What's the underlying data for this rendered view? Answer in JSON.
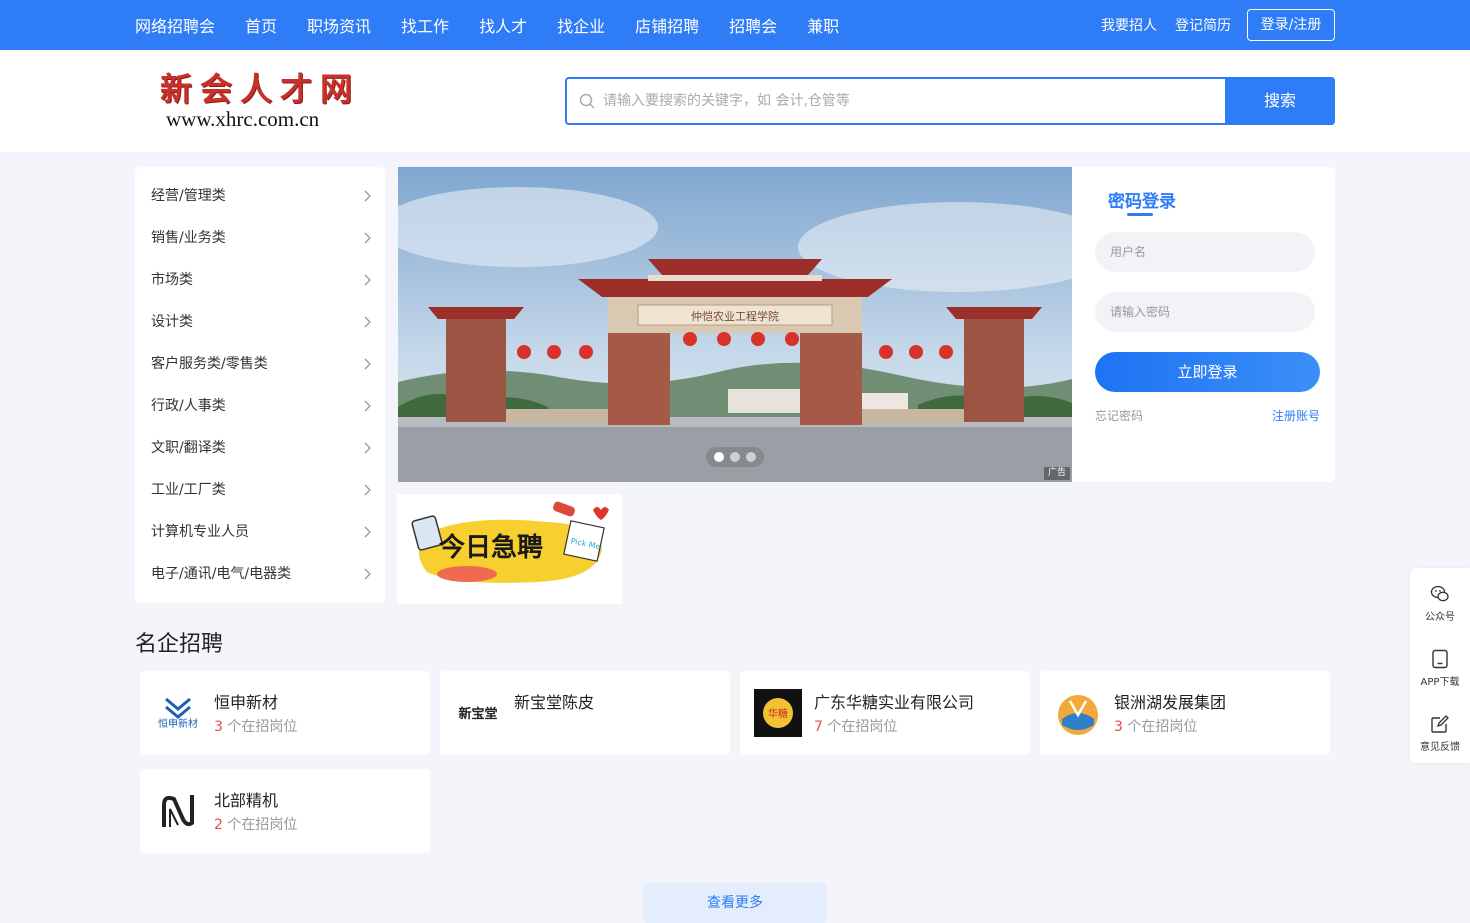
{
  "nav": {
    "items": [
      "网络招聘会",
      "首页",
      "职场资讯",
      "找工作",
      "找人才",
      "找企业",
      "店铺招聘",
      "招聘会",
      "兼职"
    ],
    "recruit": "我要招人",
    "resume": "登记简历",
    "login_register": "登录/注册",
    "bg_color": "#2e7cf6"
  },
  "logo": {
    "cn": "新会人才网",
    "url": "www.xhrc.com.cn"
  },
  "search": {
    "placeholder": "请输入要搜索的关键字，如 会计,仓管等",
    "button": "搜索"
  },
  "categories": [
    "经营/管理类",
    "销售/业务类",
    "市场类",
    "设计类",
    "客户服务类/零售类",
    "行政/人事类",
    "文职/翻译类",
    "工业/工厂类",
    "计算机专业人员",
    "电子/通讯/电气/电器类"
  ],
  "banner": {
    "ad_label": "广告",
    "gate_text": "仲恺农业工程学院",
    "slide_count": 3,
    "active_slide": 1
  },
  "login": {
    "tab": "密码登录",
    "username_placeholder": "用户名",
    "password_placeholder": "请输入密码",
    "submit": "立即登录",
    "forgot": "忘记密码",
    "register": "注册账号"
  },
  "urgent_ad": {
    "text": "今日急聘",
    "sticker": "Pick Me"
  },
  "famous": {
    "title": "名企招聘",
    "suffix": "个在招岗位",
    "companies": [
      {
        "name": "恒申新材",
        "count": "3",
        "logo_icon": "hengshen-logo-icon",
        "logo_text": "恒申新材"
      },
      {
        "name": "新宝堂陈皮",
        "count": "",
        "logo_icon": "xinbaotang-logo-icon",
        "logo_text": "新宝堂"
      },
      {
        "name": "广东华糖实业有限公司",
        "count": "7",
        "logo_icon": "huatang-logo-icon",
        "logo_text": "华糖"
      },
      {
        "name": "银洲湖发展集团",
        "count": "3",
        "logo_icon": "yinzhouhu-logo-icon",
        "logo_text": ""
      },
      {
        "name": "北部精机",
        "count": "2",
        "logo_icon": "beibu-logo-icon",
        "logo_text": ""
      }
    ],
    "more": "查看更多"
  },
  "float_bar": {
    "wechat": "公众号",
    "app": "APP下载",
    "feedback": "意见反馈"
  }
}
